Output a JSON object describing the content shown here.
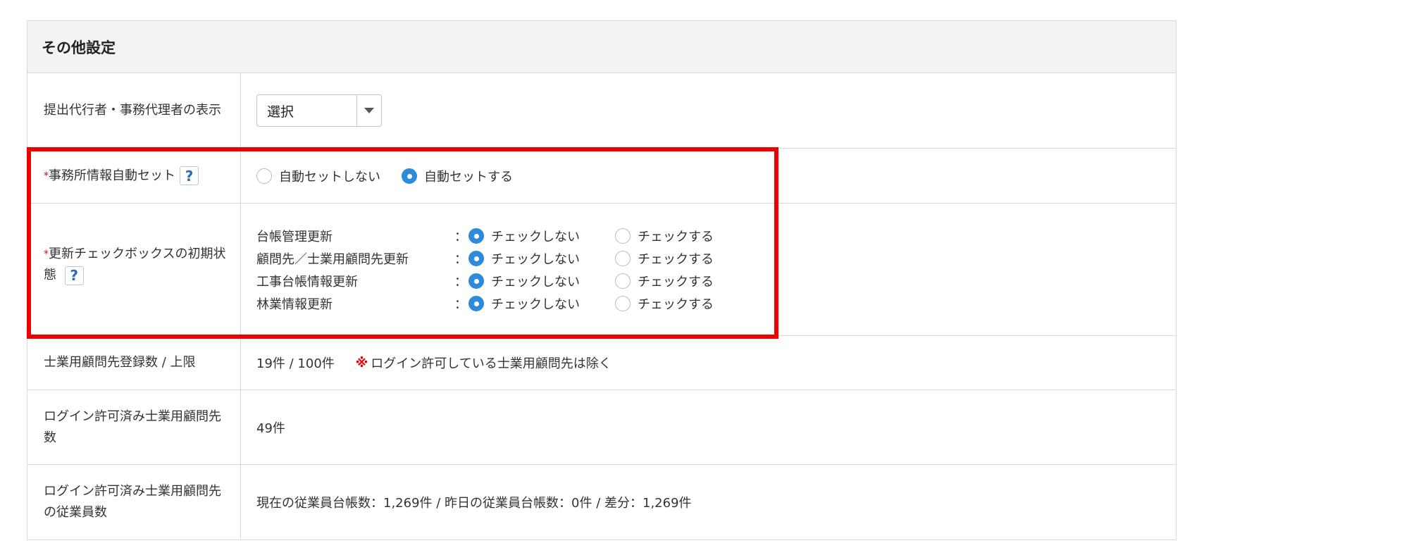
{
  "section": {
    "title": "その他設定"
  },
  "rows": {
    "proxy_display": {
      "label": "提出代行者・事務代理者の表示",
      "select_value": "選択"
    },
    "office_autoset": {
      "label": "事務所情報自動セット",
      "help": "?",
      "options": [
        "自動セットしない",
        "自動セットする"
      ],
      "selected": "自動セットする"
    },
    "update_checkbox_initial": {
      "label": "更新チェックボックスの初期状態",
      "help": "?",
      "colon": "：",
      "items": [
        {
          "name": "台帳管理更新",
          "off": "チェックしない",
          "on": "チェックする",
          "selected": "チェックしない"
        },
        {
          "name": "顧問先／士業用顧問先更新",
          "off": "チェックしない",
          "on": "チェックする",
          "selected": "チェックしない"
        },
        {
          "name": "工事台帳情報更新",
          "off": "チェックしない",
          "on": "チェックする",
          "selected": "チェックしない"
        },
        {
          "name": "林業情報更新",
          "off": "チェックしない",
          "on": "チェックする",
          "selected": "チェックしない"
        }
      ]
    },
    "client_count": {
      "label": "士業用顧問先登録数 / 上限",
      "value": "19件 / 100件",
      "note_mark": "※",
      "note": "ログイン許可している士業用顧問先は除く"
    },
    "login_clients": {
      "label": "ログイン許可済み士業用顧問先数",
      "value": "49件"
    },
    "login_client_employees": {
      "label": "ログイン許可済み士業用顧問先の従業員数",
      "value": "現在の従業員台帳数：1,269件 / 昨日の従業員台帳数：0件 / 差分：1,269件"
    }
  },
  "required_mark": "*",
  "colors": {
    "highlight": "#ee0000",
    "radio_checked": "#2d8bdb",
    "header_bg": "#f3f3f3"
  }
}
